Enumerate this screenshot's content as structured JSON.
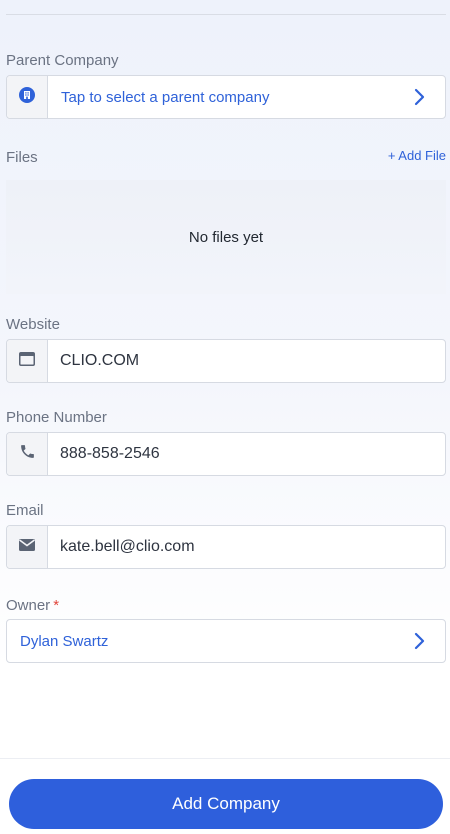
{
  "parent_company": {
    "label": "Parent Company",
    "placeholder": "Tap to select a parent company",
    "icon": "building-icon"
  },
  "files": {
    "label": "Files",
    "add_label": "+ Add File",
    "empty_text": "No files yet"
  },
  "website": {
    "label": "Website",
    "value": "CLIO.COM",
    "icon": "browser-window-icon"
  },
  "phone": {
    "label": "Phone Number",
    "value": "888-858-2546",
    "icon": "phone-icon"
  },
  "email": {
    "label": "Email",
    "value": "kate.bell@clio.com",
    "icon": "envelope-icon"
  },
  "owner": {
    "label": "Owner",
    "required_mark": "*",
    "value": "Dylan Swartz"
  },
  "submit": {
    "label": "Add Company"
  },
  "colors": {
    "accent": "#2e5fdc",
    "link": "#2f62d9",
    "required": "#e0453a"
  }
}
